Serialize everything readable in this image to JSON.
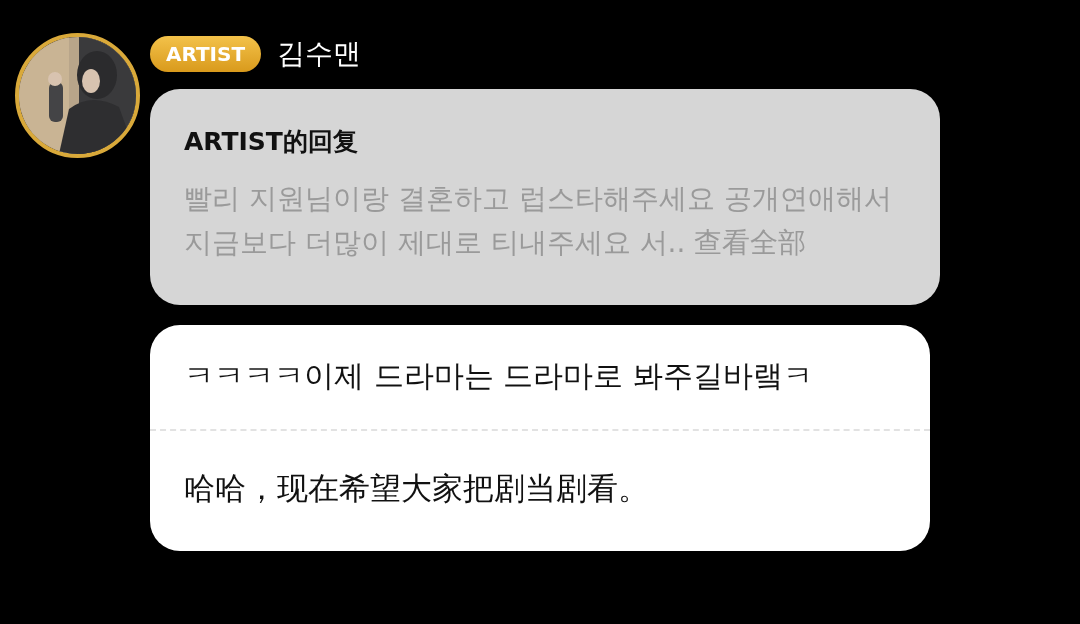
{
  "author": {
    "badge": "ARTIST",
    "name": "김수맨"
  },
  "quoted_reply": {
    "title": "ARTIST的回复",
    "text": "빨리 지원님이랑 결혼하고 럽스타해주세요 공개연애해서 지금보다 더많이 제대로 티내주세요 서..",
    "more_link": "查看全部"
  },
  "message": {
    "text": "ㅋㅋㅋㅋ이제 드라마는 드라마로 봐주길바랰ㅋ",
    "translation": "哈哈，现在希望大家把剧当剧看。"
  }
}
